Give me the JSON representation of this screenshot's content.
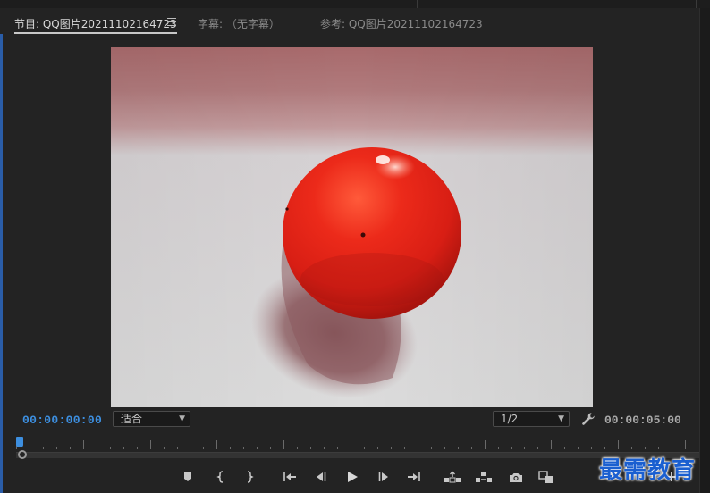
{
  "tabs": [
    {
      "label": "节目: QQ图片20211102164723",
      "active": true
    },
    {
      "label": "字幕: （无字幕）",
      "active": false
    },
    {
      "label": "参考: QQ图片20211102164723",
      "active": false
    }
  ],
  "timecode": {
    "current": "00:00:00:00",
    "duration": "00:00:05:00"
  },
  "zoom_select": {
    "value": "适合"
  },
  "resolution_select": {
    "value": "1/2"
  },
  "playhead_position": 0.0,
  "transport": [
    {
      "name": "add-marker-icon"
    },
    {
      "name": "mark-in-icon"
    },
    {
      "name": "mark-out-icon"
    },
    {
      "name": "go-to-in-icon"
    },
    {
      "name": "step-back-icon"
    },
    {
      "name": "play-icon"
    },
    {
      "name": "step-forward-icon"
    },
    {
      "name": "go-to-out-icon"
    },
    {
      "name": "lift-icon"
    },
    {
      "name": "extract-icon"
    },
    {
      "name": "export-frame-icon"
    },
    {
      "name": "comparison-view-icon"
    },
    {
      "name": "add-button-icon"
    }
  ],
  "colors": {
    "accent_blue": "#3d8fe0",
    "panel_bg": "#232323",
    "fruit_red": "#e0281c"
  },
  "watermark": "最需教育"
}
